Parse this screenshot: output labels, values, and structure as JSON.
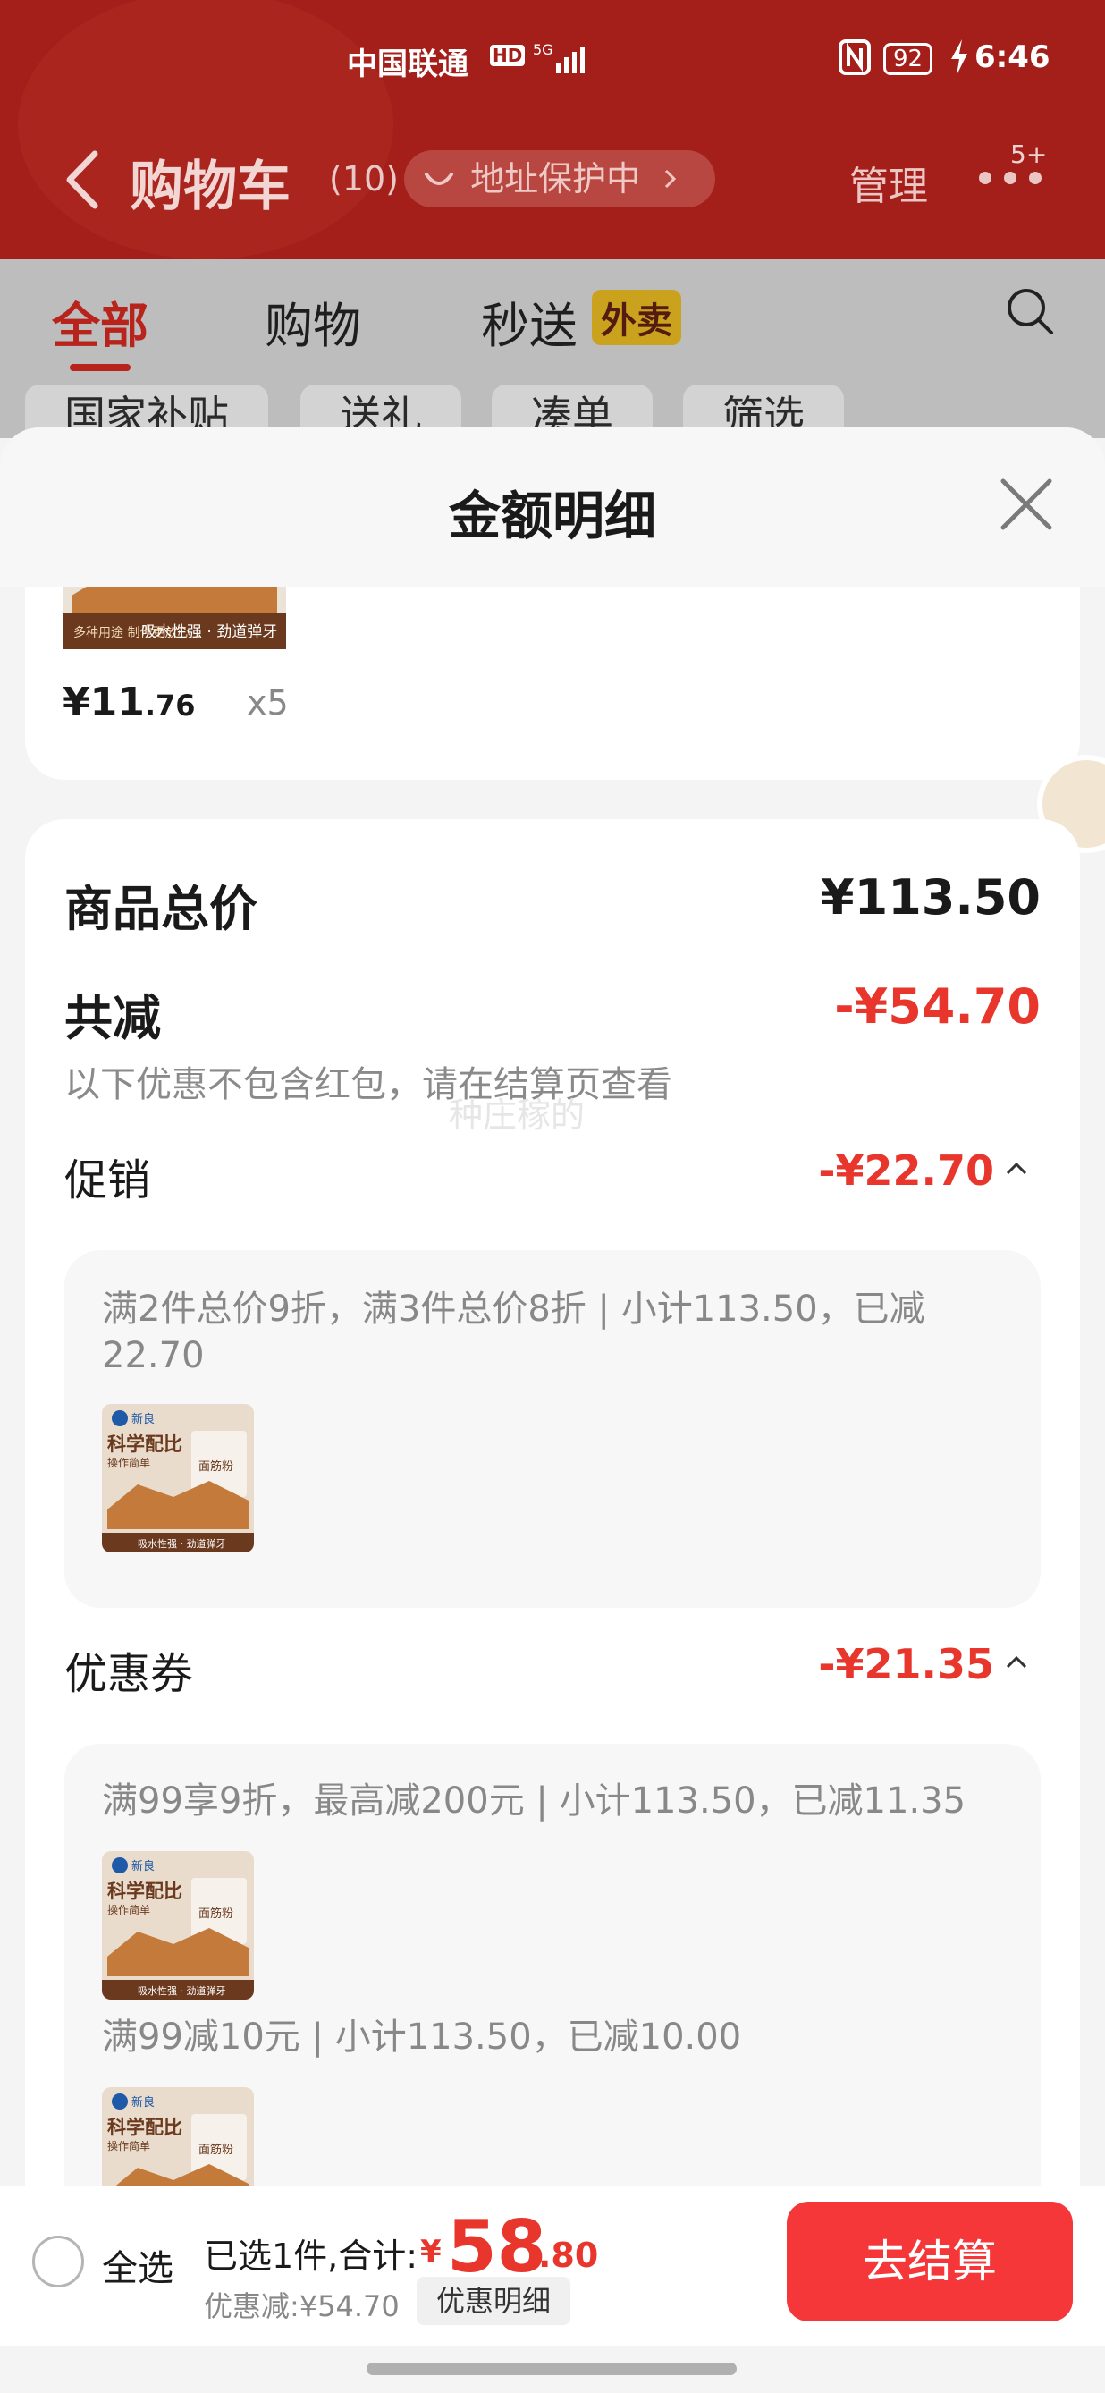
{
  "status_bar": {
    "carrier": "中国联通",
    "hd": "HD",
    "network": "5G",
    "battery": "92",
    "time": "6:46"
  },
  "nav": {
    "title": "购物车",
    "count": "(10)",
    "address_protection": "地址保护中",
    "manage": "管理",
    "badge": "5+"
  },
  "tabs": [
    {
      "label": "全部",
      "active": true
    },
    {
      "label": "购物"
    },
    {
      "label": "秒送",
      "tag": "外卖"
    }
  ],
  "filter_chips": [
    "国家补贴",
    "送礼",
    "凑单",
    "筛选"
  ],
  "sheet": {
    "title": "金额明细",
    "top_item": {
      "price_main": "¥11",
      "price_decimal": ".76",
      "qty": "x5"
    },
    "total_label": "商品总价",
    "total_value": "¥113.50",
    "reduce_label": "共减",
    "reduce_value": "-¥54.70",
    "reduce_hint": "以下优惠不包含红包，请在结算页查看",
    "watermark": "种庄稼的",
    "promo": {
      "label": "促销",
      "value": "-¥22.70",
      "detail": "满2件总价9折，满3件总价8折 | 小计113.50，已减22.70"
    },
    "coupon": {
      "label": "优惠券",
      "value": "-¥21.35",
      "detail1": "满99享9折，最高减200元 | 小计113.50，已减11.35",
      "detail2": "满99减10元 | 小计113.50，已减10.00"
    },
    "thumb": {
      "brand": "新良",
      "headline": "科学配比",
      "sub": "操作简单",
      "pack": "面筋粉",
      "strip": "吸水性强 · 劲道弹牙",
      "mini": "多种用途 制作更放心"
    }
  },
  "bottom_bar": {
    "select_all": "全选",
    "summary": "已选1件,合计:",
    "currency": "¥",
    "total_int": "58",
    "total_dec": ".80",
    "discount": "优惠减:¥54.70",
    "detail_button": "优惠明细",
    "checkout": "去结算"
  },
  "colors": {
    "header_red": "#a51f1a",
    "accent_red": "#e8362d",
    "checkout_red": "#f5373a"
  }
}
